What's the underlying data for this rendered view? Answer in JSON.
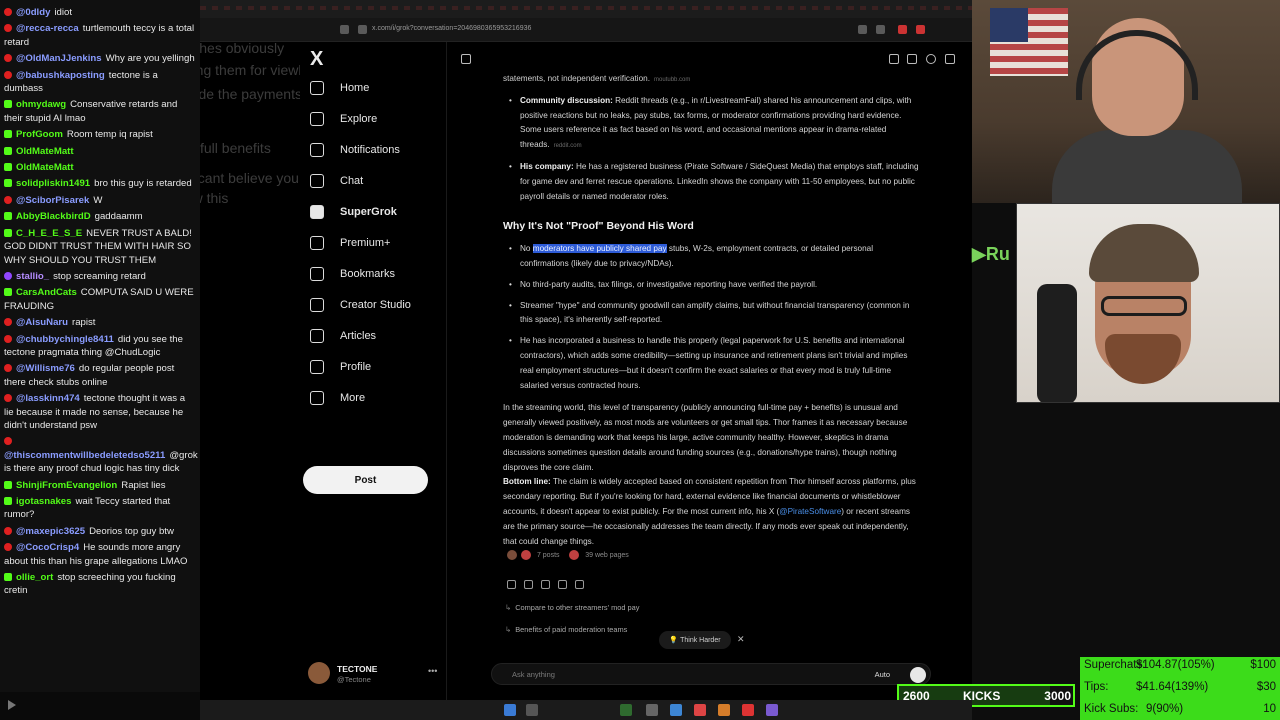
{
  "chat": [
    {
      "user": "@0dldy",
      "text": "idiot",
      "badge": "yt",
      "color": "#8a9cff"
    },
    {
      "user": "@recca-recca",
      "text": "turtlemouth teccy is a total retard",
      "badge": "yt",
      "color": "#8a9cff"
    },
    {
      "user": "@OldManJJenkins",
      "text": "Why are you yellingh",
      "badge": "yt",
      "color": "#8a9cff"
    },
    {
      "user": "@babushkaposting",
      "text": "tectone is a dumbass",
      "badge": "yt",
      "color": "#8a9cff"
    },
    {
      "user": "ohmydawg",
      "text": "Conservative retards and their stupid AI lmao",
      "badge": "kick",
      "color": "#53fc18"
    },
    {
      "user": "ProfGoom",
      "text": "Room temp iq rapist",
      "badge": "kick",
      "color": "#53fc18"
    },
    {
      "user": "OldMateMatt",
      "text": "",
      "badge": "kick",
      "color": "#53fc18"
    },
    {
      "user": "OldMateMatt",
      "text": "",
      "badge": "kick",
      "color": "#53fc18"
    },
    {
      "user": "solidpliskin1491",
      "text": "bro this guy is retarded",
      "badge": "kick",
      "color": "#53fc18"
    },
    {
      "user": "@SciborPisarek",
      "text": "W",
      "badge": "yt",
      "color": "#8a9cff"
    },
    {
      "user": "AbbyBlackbirdD",
      "text": "gaddaamm",
      "badge": "kick",
      "color": "#53fc18"
    },
    {
      "user": "C_H_E_E_S_E",
      "text": "NEVER TRUST A BALD! GOD DIDNT TRUST THEM WITH HAIR SO WHY SHOULD YOU TRUST THEM",
      "badge": "kick",
      "color": "#53fc18"
    },
    {
      "user": "stallio_",
      "text": "stop screaming retard",
      "badge": "tw",
      "color": "#b58cff"
    },
    {
      "user": "CarsAndCats",
      "text": "COMPUTA SAID U WERE FRAUDING",
      "badge": "kick",
      "color": "#53fc18"
    },
    {
      "user": "@AisuNaru",
      "text": "rapist",
      "badge": "yt",
      "color": "#8a9cff"
    },
    {
      "user": "@chubbychingle8411",
      "text": "did you see the tectone pragmata thing @ChudLogic",
      "badge": "yt",
      "color": "#8a9cff"
    },
    {
      "user": "@Willisme76",
      "text": "do regular people post there check stubs online",
      "badge": "yt",
      "color": "#8a9cff"
    },
    {
      "user": "@lasskinn474",
      "text": "tectone thought it was a lie because it made no sense, because he didn't understand psw",
      "badge": "yt",
      "color": "#8a9cff"
    },
    {
      "user": "@thiscommentwillbedeletedso5211",
      "text": "@grok is there any proof chud logic has tiny dick",
      "badge": "yt",
      "color": "#8a9cff"
    },
    {
      "user": "ShinjiFromEvangelion",
      "text": "Rapist lies",
      "badge": "kick",
      "color": "#53fc18"
    },
    {
      "user": "igotasnakes",
      "text": "wait Teccy started that rumor?",
      "badge": "kick",
      "color": "#53fc18"
    },
    {
      "user": "@maxepic3625",
      "text": "Deorios top guy btw",
      "badge": "yt",
      "color": "#8a9cff"
    },
    {
      "user": "@CocoCrisp4",
      "text": "He sounds more angry about this than his grape allegations LMAO",
      "badge": "yt",
      "color": "#8a9cff"
    },
    {
      "user": "ollie_ort",
      "text": "stop screeching you fucking cretin",
      "badge": "kick",
      "color": "#53fc18"
    }
  ],
  "ghost": [
    "nah hes obviously",
    "paying them for viewbots and is trying",
    "to hide the payments through them",
    "full benefits",
    "I cant believe you didnt",
    "know this"
  ],
  "browser": {
    "url": "x.com/i/grok?conversation=2046980365953216936"
  },
  "xnav": {
    "logo": "X",
    "items": [
      "Home",
      "Explore",
      "Notifications",
      "Chat",
      "SuperGrok",
      "Premium+",
      "Bookmarks",
      "Creator Studio",
      "Articles",
      "Profile",
      "More"
    ],
    "post": "Post",
    "profile_name": "TECTONE",
    "profile_handle": "@Tectone"
  },
  "conversation": {
    "prev_line": "statements, not independent verification.",
    "prev_chip": "moutubb.com",
    "bullets1": [
      {
        "lead": "Community discussion:",
        "text": "Reddit threads (e.g., in r/LivestreamFail) shared his announcement and clips, with positive reactions but no leaks, pay stubs, tax forms, or moderator confirmations providing hard evidence. Some users reference it as fact based on his word, and occasional mentions appear in drama-related threads.",
        "chip": "reddit.com"
      },
      {
        "lead": "His company:",
        "text": "He has a registered business (Pirate Software / SideQuest Media) that employs staff, including for game dev and ferret rescue operations. LinkedIn shows the company with 11-50 employees, but no public payroll details or named moderator roles.",
        "chip": ""
      }
    ],
    "section": "Why It's Not \"Proof\" Beyond His Word",
    "bullet_hl_pre": "No",
    "bullet_hl": "moderators have publicly shared pay",
    "bullet_hl_post": "stubs, W-2s, employment contracts, or detailed personal confirmations (likely due to privacy/NDAs).",
    "bullets2": [
      "No third-party audits, tax filings, or investigative reporting have verified the payroll.",
      "Streamer \"hype\" and community goodwill can amplify claims, but without financial transparency (common in this space), it's inherently self-reported.",
      "He has incorporated a business to handle this properly (legal paperwork for U.S. benefits and international contractors), which adds some credibility—setting up insurance and retirement plans isn't trivial and implies real employment structures—but it doesn't confirm the exact salaries or that every mod is truly full-time salaried versus contracted hours."
    ],
    "para1": "In the streaming world, this level of transparency (publicly announcing full-time pay + benefits) is unusual and generally viewed positively, as most mods are volunteers or get small tips. Thor frames it as necessary because moderation is demanding work that keeps his large, active community healthy. However, skeptics in drama discussions sometimes question details around funding sources (e.g., donations/hype trains), though nothing disproves the core claim.",
    "bottom_lead": "Bottom line:",
    "bottom_text": "The claim is widely accepted based on consistent repetition from Thor himself across platforms, plus secondary reporting. But if you're looking for hard, external evidence like financial documents or whistleblower accounts, it doesn't appear to exist publicly. For the most current info, his X (",
    "bottom_link": "@PirateSoftware",
    "bottom_tail": ") or recent streams are the primary source—he occasionally addresses the team directly. If any mods ever speak out independently, that could change things.",
    "sources_posts": "7 posts",
    "sources_web": "39 web pages",
    "suggest1": "Compare to other streamers' mod pay",
    "suggest2": "Benefits of paid moderation teams",
    "think": "Think Harder",
    "ask_placeholder": "Ask anything",
    "ask_mode": "Auto"
  },
  "overlay": {
    "rumble": "Ru",
    "superchats_label": "Superchats:",
    "superchats_value": "$104.87(105%)",
    "superchats_goal": "$100",
    "tips_label": "Tips:",
    "tips_value": "$41.64(139%)",
    "tips_goal": "$30",
    "kicksubs_label": "Kick Subs:",
    "kicksubs_value": "9(90%)",
    "kicksubs_goal": "10",
    "kicks_left": "2600",
    "kicks_label": "KICKS",
    "kicks_right": "3000",
    "kicks_progress": 0.87
  }
}
